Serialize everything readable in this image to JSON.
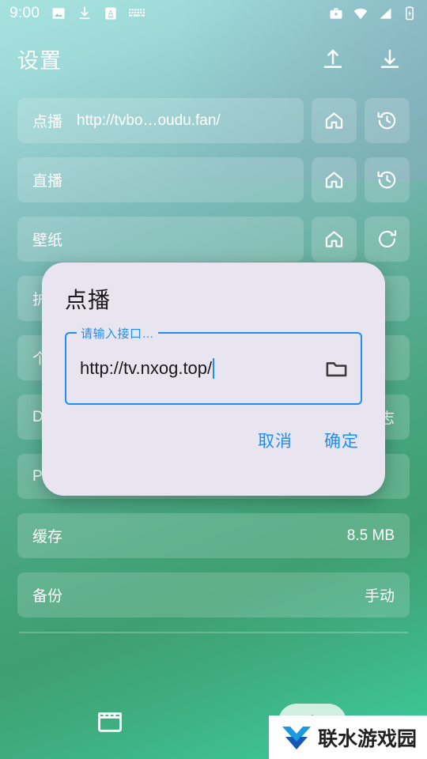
{
  "statusbar": {
    "time": "9:00",
    "left_icons": [
      "image-icon",
      "download-icon",
      "font-a-icon",
      "keyboard-icon"
    ],
    "right_icons": [
      "work-briefcase-icon",
      "wifi-icon",
      "cellular-signal-icon",
      "battery-charging-icon"
    ]
  },
  "appbar": {
    "title": "设置",
    "upload_label": "upload-icon",
    "download_label": "download-icon"
  },
  "settings_rows": [
    {
      "label": "点播",
      "value": "http://tvbo…oudu.fan/",
      "value_inline": true,
      "buttons": [
        "home-icon",
        "history-icon"
      ]
    },
    {
      "label": "直播",
      "value": "",
      "value_inline": true,
      "buttons": [
        "home-icon",
        "history-icon"
      ]
    },
    {
      "label": "壁纸",
      "value": "",
      "value_inline": true,
      "buttons": [
        "home-icon",
        "refresh-icon"
      ]
    },
    {
      "label": "护",
      "value": "",
      "value_inline": true,
      "buttons": []
    },
    {
      "label": "个",
      "value": "",
      "value_inline": true,
      "buttons": []
    },
    {
      "label": "D",
      "value": "志",
      "value_inline": false,
      "buttons": []
    },
    {
      "label": "Proxy",
      "value": "",
      "value_inline": false,
      "buttons": []
    },
    {
      "label": "缓存",
      "value": "8.5 MB",
      "value_inline": false,
      "buttons": []
    },
    {
      "label": "备份",
      "value": "手动",
      "value_inline": false,
      "buttons": []
    }
  ],
  "bottombar": {
    "movie_icon": "clapperboard-icon",
    "fab_icon": "add-icon"
  },
  "dialog": {
    "title": "点播",
    "field_label": "请输入接口…",
    "field_value": "http://tv.nxog.top/",
    "folder_icon": "folder-icon",
    "cancel_label": "取消",
    "confirm_label": "确定"
  },
  "watermark": {
    "text": "联水游戏园"
  },
  "colors": {
    "bg_top_left": "#a6e2dd",
    "bg_top_right": "#8fb3c0",
    "bg_bottom": "#3ecc99",
    "dialog_bg": "#e9e5f0",
    "accent_blue": "#1f8ef1",
    "row_bg": "rgba(255,255,255,0.17)",
    "text_white": "#ffffff"
  }
}
